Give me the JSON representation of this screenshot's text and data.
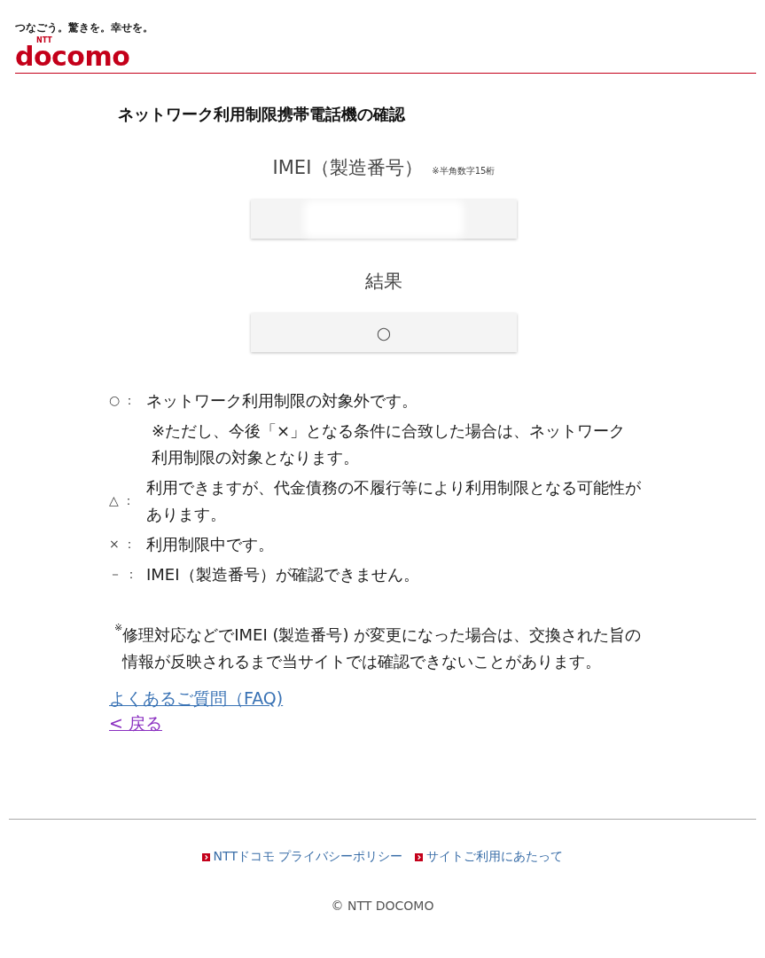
{
  "header": {
    "tagline": "つなごう。驚きを。幸せを。",
    "logo_small": "NTT",
    "logo": "docomo"
  },
  "title": "ネットワーク利用制限携帯電話機の確認",
  "imei": {
    "label": "IMEI（製造番号）",
    "hint": "※半角数字15桁",
    "redacted": true
  },
  "result": {
    "label": "結果",
    "value": "○"
  },
  "legend": [
    {
      "symbol": "○",
      "sep": "：",
      "text": "ネットワーク利用制限の対象外です。",
      "note": "※ただし、今後「×」となる条件に合致した場合は、ネットワーク利用制限の対象となります。"
    },
    {
      "symbol": "△",
      "sep": "：",
      "text": "利用できますが、代金債務の不履行等により利用制限となる可能性があります。"
    },
    {
      "symbol": "×",
      "sep": "：",
      "text": "利用制限中です。"
    },
    {
      "symbol": "－",
      "sep": "：",
      "text": "IMEI（製造番号）が確認できません。"
    }
  ],
  "footnote": {
    "mark": "※",
    "text": "修理対応などでIMEI (製造番号) が変更になった場合は、交換された旨の情報が反映されるまで当サイトでは確認できないことがあります。"
  },
  "links": [
    {
      "text": "よくあるご質問（FAQ)",
      "visited": false
    },
    {
      "text": "< 戻る",
      "visited": true
    }
  ],
  "footer": {
    "links": [
      "NTTドコモ プライバシーポリシー",
      "サイトご利用にあたって"
    ],
    "copyright": "© NTT DOCOMO"
  }
}
